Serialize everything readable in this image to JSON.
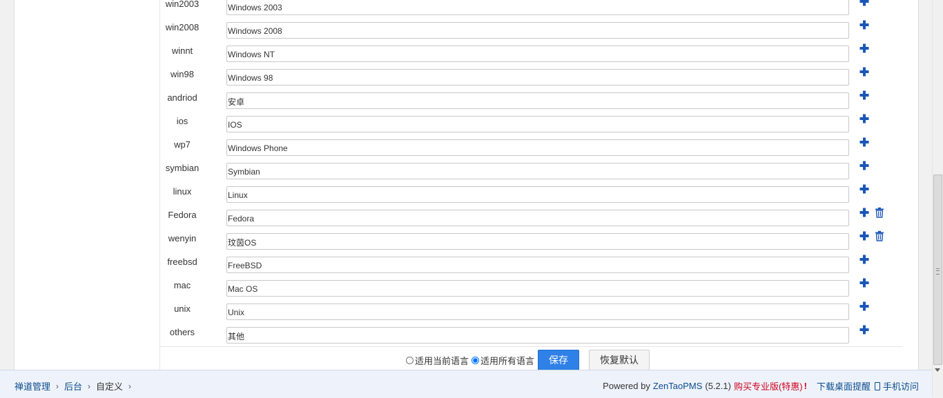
{
  "rows": [
    {
      "key": "win2003",
      "value": "Windows 2003",
      "deletable": false
    },
    {
      "key": "win2008",
      "value": "Windows 2008",
      "deletable": false
    },
    {
      "key": "winnt",
      "value": "Windows NT",
      "deletable": false
    },
    {
      "key": "win98",
      "value": "Windows 98",
      "deletable": false
    },
    {
      "key": "andriod",
      "value": "安卓",
      "deletable": false
    },
    {
      "key": "ios",
      "value": "IOS",
      "deletable": false
    },
    {
      "key": "wp7",
      "value": "Windows Phone",
      "deletable": false
    },
    {
      "key": "symbian",
      "value": "Symbian",
      "deletable": false
    },
    {
      "key": "linux",
      "value": "Linux",
      "deletable": false
    },
    {
      "key": "Fedora",
      "value": "Fedora",
      "deletable": true
    },
    {
      "key": "wenyin",
      "value": "玟茵OS",
      "deletable": true
    },
    {
      "key": "freebsd",
      "value": "FreeBSD",
      "deletable": false
    },
    {
      "key": "mac",
      "value": "Mac OS",
      "deletable": false
    },
    {
      "key": "unix",
      "value": "Unix",
      "deletable": false
    },
    {
      "key": "others",
      "value": "其他",
      "deletable": false
    }
  ],
  "actions": {
    "lang_current_label": "适用当前语言",
    "lang_all_label": "适用所有语言",
    "selected_lang": "all",
    "save_label": "保存",
    "reset_label": "恢复默认"
  },
  "footer": {
    "breadcrumb": [
      "禅道管理",
      "后台",
      "自定义"
    ],
    "powered_by": "Powered by",
    "product_name": "ZenTaoPMS",
    "version": "(5.2.1)",
    "buy_label": "购买专业版(特惠)",
    "buy_bang": "!",
    "desktop_label": "下载桌面提醒",
    "mobile_label": "手机访问"
  },
  "colors": {
    "accent": "#2f80e7",
    "icon_blue": "#1a56b8",
    "link": "#0b4c8c",
    "buy_red": "#d0021b"
  },
  "icons": {
    "add": "plus-icon",
    "delete": "trash-icon",
    "mobile": "mobile-phone-icon"
  }
}
